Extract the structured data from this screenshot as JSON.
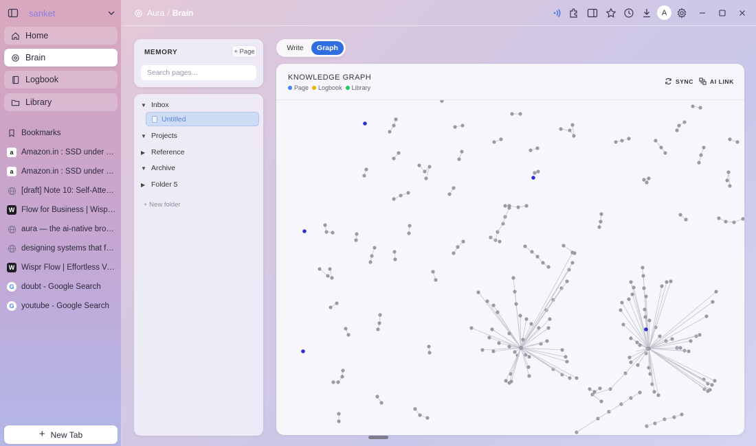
{
  "sidebar": {
    "brand": "sanket",
    "nav": [
      {
        "label": "Home",
        "icon": "home-icon"
      },
      {
        "label": "Brain",
        "icon": "brain-icon",
        "active": true
      },
      {
        "label": "Logbook",
        "icon": "book-icon"
      },
      {
        "label": "Library",
        "icon": "folder-icon"
      }
    ],
    "bookmarks_label": "Bookmarks",
    "tabs": [
      {
        "label": "Amazon.in : SSD under 10...",
        "icon": "amazon-icon"
      },
      {
        "label": "Amazon.in : SSD under 10...",
        "icon": "amazon-icon"
      },
      {
        "label": "[draft] Note 10: Self-Attent...",
        "icon": "globe-icon"
      },
      {
        "label": "Flow for Business | Wispr F...",
        "icon": "wispr-icon"
      },
      {
        "label": "aura — the ai-native brow...",
        "icon": "globe-icon"
      },
      {
        "label": "designing systems that fa...",
        "icon": "globe-icon"
      },
      {
        "label": "Wispr Flow | Effortless Voi...",
        "icon": "wispr-icon"
      },
      {
        "label": "doubt - Google Search",
        "icon": "google-icon"
      },
      {
        "label": "youtube - Google Search",
        "icon": "google-icon"
      }
    ],
    "new_tab": "New Tab"
  },
  "breadcrumb": {
    "root": "Aura",
    "sep": "/",
    "current": "Brain"
  },
  "avatar": "A",
  "memory": {
    "title": "MEMORY",
    "add_page": "+ Page",
    "search_placeholder": "Search pages...",
    "tree": [
      {
        "label": "Inbox",
        "expanded": true
      },
      {
        "label": "Untitled",
        "selected": true
      },
      {
        "label": "Projects",
        "expanded": true
      },
      {
        "label": "Reference",
        "expanded": false
      },
      {
        "label": "Archive",
        "expanded": true
      },
      {
        "label": "Folder 5",
        "expanded": false
      }
    ],
    "new_folder": "+ New folder"
  },
  "mode": {
    "write": "Write",
    "graph": "Graph",
    "active": "Graph"
  },
  "graph": {
    "title": "KNOWLEDGE GRAPH",
    "legend": [
      {
        "label": "Page",
        "color": "#3b82f6"
      },
      {
        "label": "Logbook",
        "color": "#eab308"
      },
      {
        "label": "Library",
        "color": "#22c55e"
      }
    ],
    "sync": "SYNC",
    "ai_link": "AI LINK",
    "node_color": "#9a9aa6",
    "highlight_color": "#2f2fd0"
  },
  "colors": {
    "accent": "#2f6de0",
    "selected_bg": "#cfdcf5"
  }
}
